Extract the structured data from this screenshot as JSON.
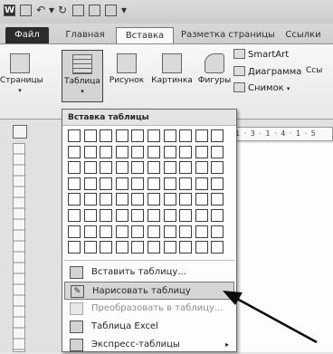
{
  "tabs": {
    "file": "Файл",
    "home": "Главная",
    "insert": "Вставка",
    "page_layout": "Разметка страницы",
    "references": "Ссылки"
  },
  "ribbon": {
    "pages": "Страницы",
    "table": "Таблица",
    "picture": "Рисунок",
    "clipart": "Картинка",
    "shapes": "Фигуры",
    "smartart": "SmartArt",
    "chart": "Диаграмма",
    "screenshot": "Снимок",
    "links_fragment": "Ссы",
    "dropdown_arrow": "▾"
  },
  "ruler": {
    "marks": "· 1 · 3 · 1 · 4 · 1 · 5"
  },
  "table_menu": {
    "header": "Вставка таблицы",
    "grid": {
      "columns": 10,
      "rows": 8
    },
    "items": [
      {
        "label": "Вставить таблицу...",
        "icon": "insert-table-icon",
        "state": "normal"
      },
      {
        "label": "Нарисовать таблицу",
        "icon": "draw-table-pencil-icon",
        "state": "highlighted"
      },
      {
        "label": "Преобразовать в таблицу...",
        "icon": "convert-table-icon",
        "state": "disabled"
      },
      {
        "label": "Таблица Excel",
        "icon": "excel-table-icon",
        "state": "normal"
      },
      {
        "label": "Экспресс-таблицы",
        "icon": "quick-tables-icon",
        "state": "normal",
        "submenu": "▸"
      }
    ]
  }
}
